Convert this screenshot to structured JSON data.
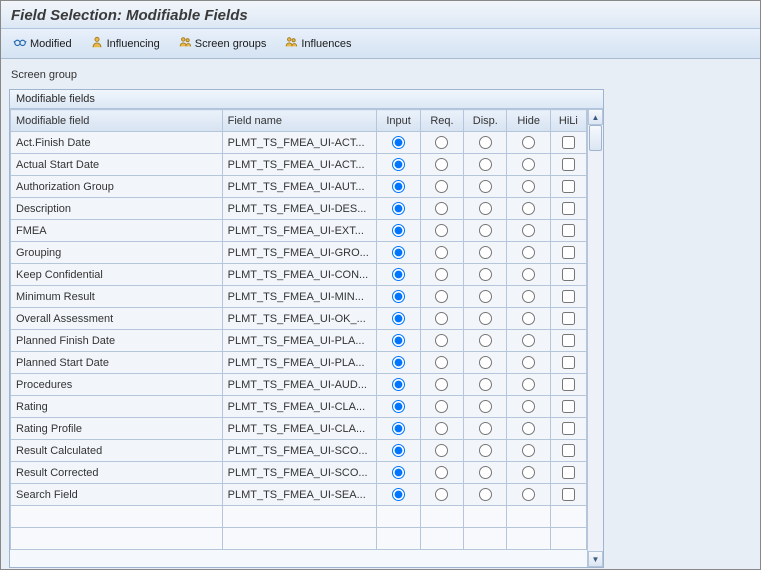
{
  "title": "Field Selection: Modifiable Fields",
  "toolbar": {
    "modified": "Modified",
    "influencing": "Influencing",
    "screen_groups": "Screen groups",
    "influences": "Influences"
  },
  "screen_group_label": "Screen group",
  "table": {
    "caption": "Modifiable fields",
    "headers": {
      "modifiable_field": "Modifiable field",
      "field_name": "Field name",
      "input": "Input",
      "req": "Req.",
      "disp": "Disp.",
      "hide": "Hide",
      "hili": "HiLi"
    },
    "rows": [
      {
        "modifiable_field": "Act.Finish Date",
        "field_name": "PLMT_TS_FMEA_UI-ACT...",
        "sel": "input",
        "hili": false
      },
      {
        "modifiable_field": "Actual Start Date",
        "field_name": "PLMT_TS_FMEA_UI-ACT...",
        "sel": "input",
        "hili": false
      },
      {
        "modifiable_field": "Authorization Group",
        "field_name": "PLMT_TS_FMEA_UI-AUT...",
        "sel": "input",
        "hili": false
      },
      {
        "modifiable_field": "Description",
        "field_name": "PLMT_TS_FMEA_UI-DES...",
        "sel": "input",
        "hili": false
      },
      {
        "modifiable_field": "FMEA",
        "field_name": "PLMT_TS_FMEA_UI-EXT...",
        "sel": "input",
        "hili": false
      },
      {
        "modifiable_field": "Grouping",
        "field_name": "PLMT_TS_FMEA_UI-GRO...",
        "sel": "input",
        "hili": false
      },
      {
        "modifiable_field": "Keep Confidential",
        "field_name": "PLMT_TS_FMEA_UI-CON...",
        "sel": "input",
        "hili": false
      },
      {
        "modifiable_field": "Minimum Result",
        "field_name": "PLMT_TS_FMEA_UI-MIN...",
        "sel": "input",
        "hili": false
      },
      {
        "modifiable_field": "Overall Assessment",
        "field_name": "PLMT_TS_FMEA_UI-OK_...",
        "sel": "input",
        "hili": false
      },
      {
        "modifiable_field": "Planned Finish Date",
        "field_name": "PLMT_TS_FMEA_UI-PLA...",
        "sel": "input",
        "hili": false
      },
      {
        "modifiable_field": "Planned Start Date",
        "field_name": "PLMT_TS_FMEA_UI-PLA...",
        "sel": "input",
        "hili": false
      },
      {
        "modifiable_field": "Procedures",
        "field_name": "PLMT_TS_FMEA_UI-AUD...",
        "sel": "input",
        "hili": false
      },
      {
        "modifiable_field": "Rating",
        "field_name": "PLMT_TS_FMEA_UI-CLA...",
        "sel": "input",
        "hili": false
      },
      {
        "modifiable_field": "Rating Profile",
        "field_name": "PLMT_TS_FMEA_UI-CLA...",
        "sel": "input",
        "hili": false
      },
      {
        "modifiable_field": "Result Calculated",
        "field_name": "PLMT_TS_FMEA_UI-SCO...",
        "sel": "input",
        "hili": false
      },
      {
        "modifiable_field": "Result Corrected",
        "field_name": "PLMT_TS_FMEA_UI-SCO...",
        "sel": "input",
        "hili": false
      },
      {
        "modifiable_field": "Search Field",
        "field_name": "PLMT_TS_FMEA_UI-SEA...",
        "sel": "input",
        "hili": false
      }
    ]
  }
}
